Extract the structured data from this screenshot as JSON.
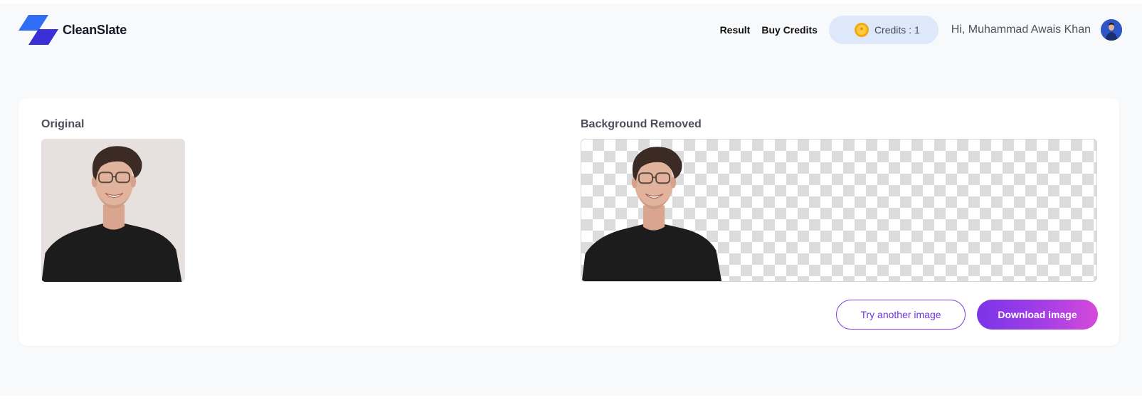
{
  "app": {
    "name": "CleanSlate"
  },
  "nav": {
    "result_label": "Result",
    "buy_credits_label": "Buy Credits",
    "credits_label": "Credits : 1",
    "greeting": "Hi, Muhammad Awais Khan"
  },
  "main": {
    "original_label": "Original",
    "removed_label": "Background Removed",
    "try_another_label": "Try another image",
    "download_label": "Download image"
  },
  "colors": {
    "accent": "#7b3fe4",
    "gradient_start": "#7a35e8",
    "gradient_end": "#d64ad8",
    "logo_blue": "#2f6ef5",
    "logo_indigo": "#3a2fd6",
    "credits_bg": "#dde8fb",
    "coin": "#f5a80e"
  },
  "icons": {
    "logo": "cleanslate-logo-icon",
    "credits": "coin-icon",
    "user": "avatar"
  }
}
